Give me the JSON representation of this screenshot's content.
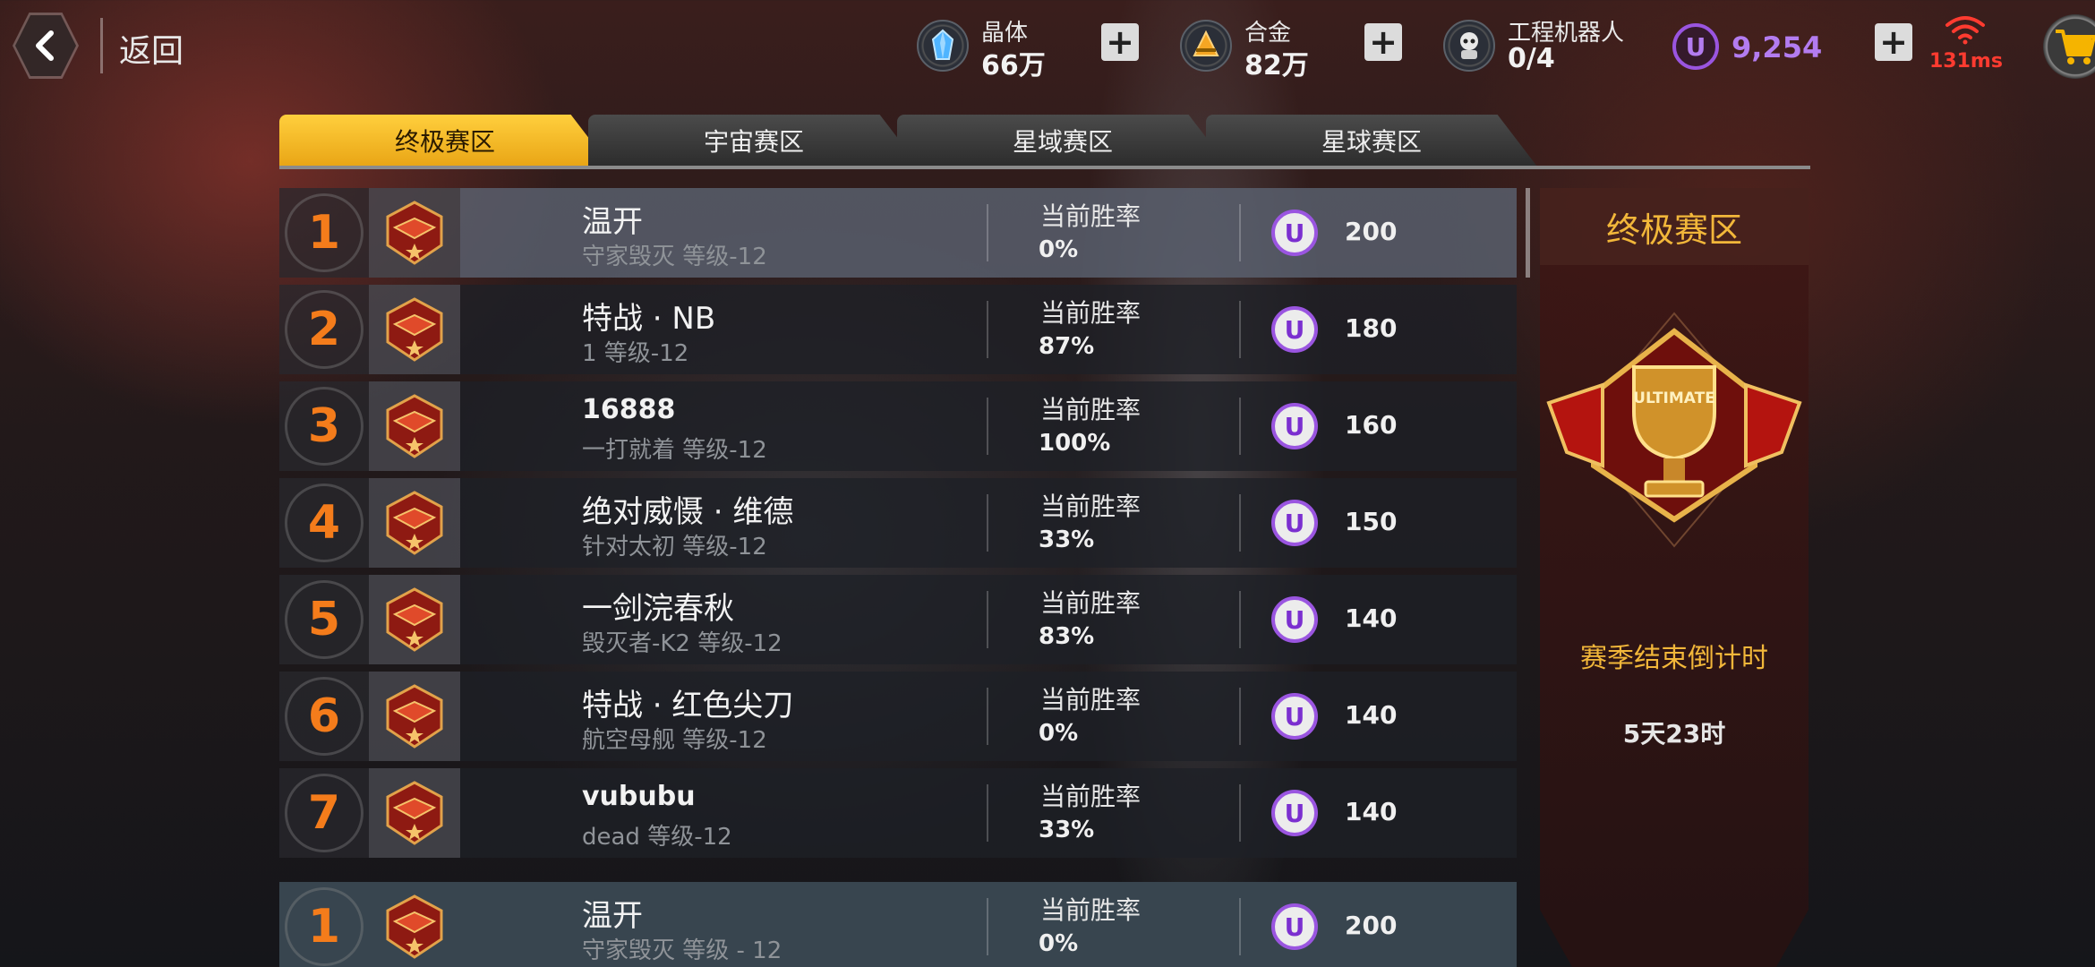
{
  "header": {
    "back_label": "返回",
    "resources": [
      {
        "name": "晶体",
        "value": "66万",
        "icon": "crystal-icon"
      },
      {
        "name": "合金",
        "value": "82万",
        "icon": "alloy-icon"
      },
      {
        "name": "工程机器人",
        "value": "0/4",
        "icon": "robot-icon"
      }
    ],
    "ucoin_symbol": "U",
    "ucoin_value": "9,254",
    "ping": "131ms"
  },
  "tabs": [
    {
      "label": "终极赛区",
      "active": true
    },
    {
      "label": "宇宙赛区",
      "active": false
    },
    {
      "label": "星域赛区",
      "active": false
    },
    {
      "label": "星球赛区",
      "active": false
    }
  ],
  "ranking": {
    "winrate_label": "当前胜率",
    "coin_symbol": "U",
    "rows": [
      {
        "rank": "1",
        "name": "温开",
        "sub": "守家毁灭 等级-12",
        "winrate": "0%",
        "reward": "200"
      },
      {
        "rank": "2",
        "name": "特战 · NB",
        "sub": "1 等级-12",
        "winrate": "87%",
        "reward": "180"
      },
      {
        "rank": "3",
        "name": "16888",
        "sub": "一打就着 等级-12",
        "winrate": "100%",
        "reward": "160"
      },
      {
        "rank": "4",
        "name": "绝对威慑 · 维德",
        "sub": "针对太初 等级-12",
        "winrate": "33%",
        "reward": "150"
      },
      {
        "rank": "5",
        "name": "一剑浣春秋",
        "sub": "毁灭者-K2 等级-12",
        "winrate": "83%",
        "reward": "140"
      },
      {
        "rank": "6",
        "name": "特战 · 红色尖刀",
        "sub": "航空母舰 等级-12",
        "winrate": "0%",
        "reward": "140"
      },
      {
        "rank": "7",
        "name": "vububu",
        "sub": "dead 等级-12",
        "winrate": "33%",
        "reward": "140"
      }
    ],
    "my_row": {
      "rank": "1",
      "name": "温开",
      "sub": "守家毁灭 等级 - 12",
      "winrate": "0%",
      "reward": "200"
    }
  },
  "side_panel": {
    "title": "终极赛区",
    "emblem_text": "ULTIMATE",
    "countdown_label": "赛季结束倒计时",
    "countdown_value": "5天23时"
  },
  "colors": {
    "tab_active": "#f2b725",
    "rank_number": "#f47c1b",
    "ucoin": "#9a55e0",
    "side_title": "#f2b73a",
    "ping": "#ff3b30"
  }
}
